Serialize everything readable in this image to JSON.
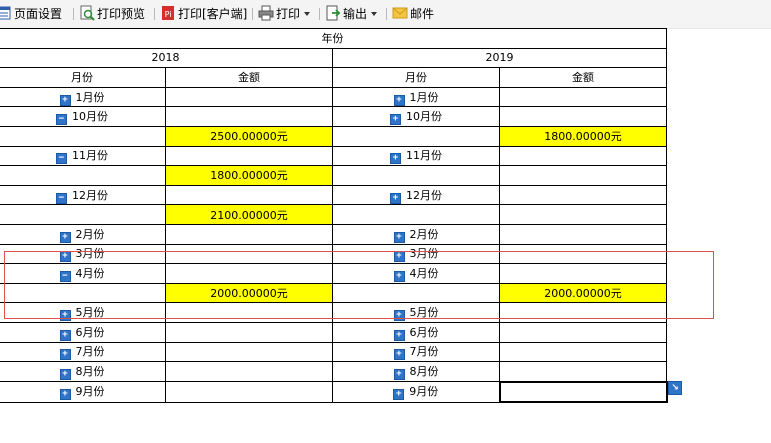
{
  "toolbar": {
    "page_setup": "页面设置",
    "print_preview": "打印预览",
    "print_client": "打印[客户端]",
    "print": "打印",
    "export": "输出",
    "mail": "邮件"
  },
  "report": {
    "header_top": "年份",
    "year_1": "2018",
    "year_2": "2019",
    "col_month": "月份",
    "col_amount": "金额",
    "rows": [
      {
        "m1": "1月份",
        "e1": "+",
        "a1": "",
        "m2": "1月份",
        "e2": "+",
        "a2": ""
      },
      {
        "m1": "10月份",
        "e1": "−",
        "a1": "",
        "m2": "10月份",
        "e2": "+",
        "a2": ""
      },
      {
        "m1": "",
        "e1": "",
        "a1": "2500.00000元",
        "m2": "",
        "e2": "",
        "a2": "1800.00000元"
      },
      {
        "m1": "11月份",
        "e1": "−",
        "a1": "",
        "m2": "11月份",
        "e2": "+",
        "a2": ""
      },
      {
        "m1": "",
        "e1": "",
        "a1": "1800.00000元",
        "m2": "",
        "e2": "",
        "a2": ""
      },
      {
        "m1": "12月份",
        "e1": "−",
        "a1": "",
        "m2": "12月份",
        "e2": "+",
        "a2": ""
      },
      {
        "m1": "",
        "e1": "",
        "a1": "2100.00000元",
        "m2": "",
        "e2": "",
        "a2": ""
      },
      {
        "m1": "2月份",
        "e1": "+",
        "a1": "",
        "m2": "2月份",
        "e2": "+",
        "a2": ""
      },
      {
        "m1": "3月份",
        "e1": "+",
        "a1": "",
        "m2": "3月份",
        "e2": "+",
        "a2": ""
      },
      {
        "m1": "4月份",
        "e1": "−",
        "a1": "",
        "m2": "4月份",
        "e2": "+",
        "a2": ""
      },
      {
        "m1": "",
        "e1": "",
        "a1": "2000.00000元",
        "m2": "",
        "e2": "",
        "a2": "2000.00000元"
      },
      {
        "m1": "5月份",
        "e1": "+",
        "a1": "",
        "m2": "5月份",
        "e2": "+",
        "a2": ""
      },
      {
        "m1": "6月份",
        "e1": "+",
        "a1": "",
        "m2": "6月份",
        "e2": "+",
        "a2": ""
      },
      {
        "m1": "7月份",
        "e1": "+",
        "a1": "",
        "m2": "7月份",
        "e2": "+",
        "a2": ""
      },
      {
        "m1": "8月份",
        "e1": "+",
        "a1": "",
        "m2": "8月份",
        "e2": "+",
        "a2": ""
      },
      {
        "m1": "9月份",
        "e1": "+",
        "a1": "",
        "m2": "9月份",
        "e2": "+",
        "a2": ""
      }
    ]
  },
  "colors": {
    "highlight_fill": "#ffff00",
    "expander_blue": "#2f74c8",
    "annotation_red": "#d9534f"
  },
  "icons": {
    "page_setup": "page-setup-icon",
    "print_preview": "print-preview-icon",
    "print_client": "pdf-print-icon",
    "print": "printer-icon",
    "export": "export-icon",
    "mail": "mail-icon",
    "expand": "expand-icon",
    "collapse": "collapse-icon",
    "resize": "resize-handle-icon"
  }
}
